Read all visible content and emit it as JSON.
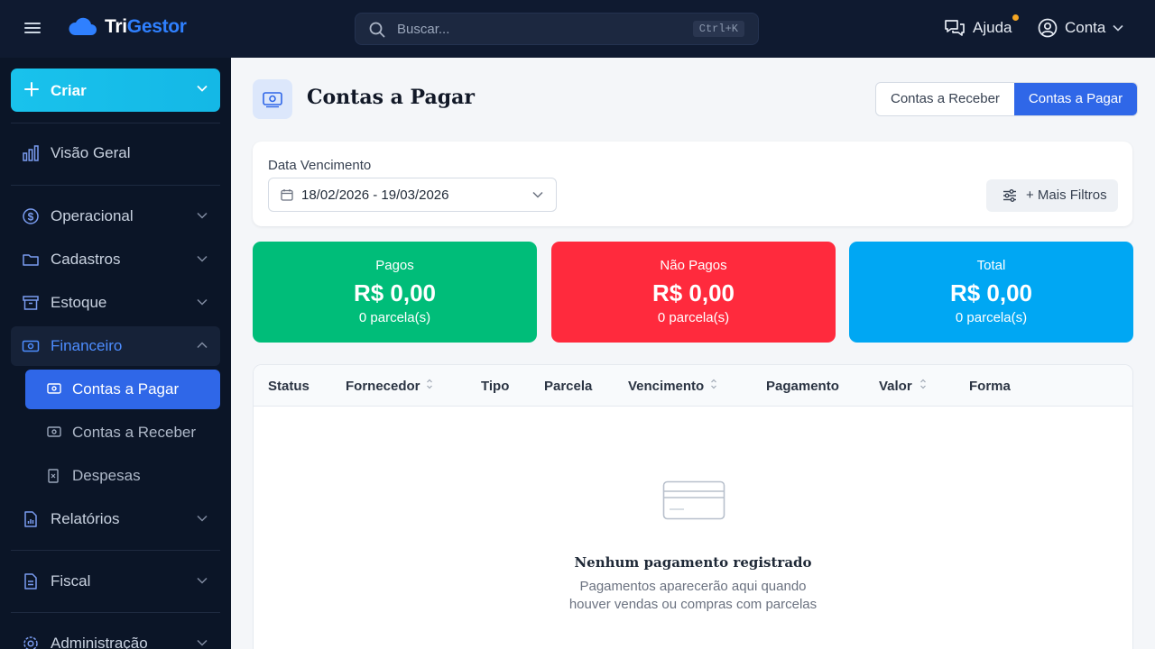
{
  "app": {
    "brand_tri": "Tri",
    "brand_gestor": "Gestor",
    "brand_color": "#2f80ff"
  },
  "header": {
    "search_placeholder": "Buscar...",
    "search_shortcut": "Ctrl+K",
    "help_label": "Ajuda",
    "account_label": "Conta"
  },
  "sidebar": {
    "create_label": "Criar",
    "items": [
      {
        "label": "Visão Geral",
        "icon": "bar-chart-icon"
      },
      {
        "label": "Operacional",
        "icon": "dollar-circle-icon"
      },
      {
        "label": "Cadastros",
        "icon": "folder-icon"
      },
      {
        "label": "Estoque",
        "icon": "archive-box-icon"
      },
      {
        "label": "Financeiro",
        "icon": "banknote-icon"
      },
      {
        "label": "Relatórios",
        "icon": "report-icon"
      },
      {
        "label": "Fiscal",
        "icon": "document-icon"
      },
      {
        "label": "Administração",
        "icon": "gear-icon"
      }
    ],
    "financeiro_sub": [
      {
        "label": "Contas a Pagar",
        "icon": "banknote-icon"
      },
      {
        "label": "Contas a Receber",
        "icon": "banknote-icon"
      },
      {
        "label": "Despesas",
        "icon": "receipt-icon"
      }
    ]
  },
  "page": {
    "title": "Contas a Pagar",
    "toggle": {
      "receivable": "Contas a Receber",
      "payable": "Contas a Pagar"
    }
  },
  "filters": {
    "date_label": "Data Vencimento",
    "date_range": "18/02/2026 - 19/03/2026",
    "more_filters": "+ Mais Filtros"
  },
  "stats": [
    {
      "title": "Pagos",
      "value": "R$ 0,00",
      "count": "0 parcela(s)",
      "color": "#00bd79"
    },
    {
      "title": "Não Pagos",
      "value": "R$ 0,00",
      "count": "0 parcela(s)",
      "color": "#ff2a3d"
    },
    {
      "title": "Total",
      "value": "R$ 0,00",
      "count": "0 parcela(s)",
      "color": "#00a7f3"
    }
  ],
  "table": {
    "columns": [
      "Status",
      "Fornecedor",
      "Tipo",
      "Parcela",
      "Vencimento",
      "Pagamento",
      "Valor",
      "Forma"
    ],
    "empty_title": "Nenhum pagamento registrado",
    "empty_line1": "Pagamentos aparecerão aqui quando",
    "empty_line2": "houver vendas ou compras com parcelas"
  }
}
